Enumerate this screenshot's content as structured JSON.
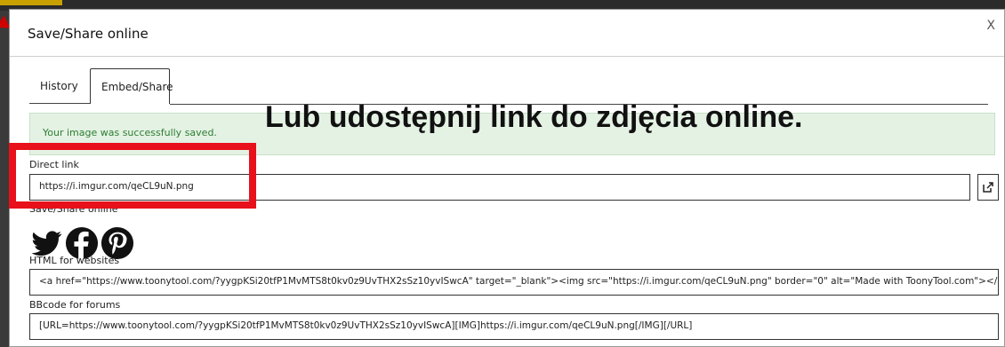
{
  "dialog": {
    "title": "Save/Share online",
    "close_label": "X"
  },
  "tabs": [
    {
      "label": "History"
    },
    {
      "label": "Embed/Share"
    }
  ],
  "alert": {
    "message": "Your image was successfully saved."
  },
  "overlay_caption": "Lub udostępnij link do zdjęcia online.",
  "direct_link": {
    "label": "Direct link",
    "value": "https://i.imgur.com/qeCL9uN.png"
  },
  "share": {
    "label": "Save/Share online",
    "icons": [
      "twitter-icon",
      "facebook-icon",
      "pinterest-icon"
    ]
  },
  "html_websites": {
    "label": "HTML for websites",
    "value": "<a href=\"https://www.toonytool.com/?yygpKSi20tfP1MvMTS8t0kv0z9UvTHX2sSz10yvISwcA\" target=\"_blank\"><img src=\"https://i.imgur.com/qeCL9uN.png\" border=\"0\" alt=\"Made with ToonyTool.com\"></a>"
  },
  "bbcode": {
    "label": "BBcode for forums",
    "value": "[URL=https://www.toonytool.com/?yygpKSi20tfP1MvMTS8t0kv0z9UvTHX2sSz10yvISwcA][IMG]https://i.imgur.com/qeCL9uN.png[/IMG][/URL]"
  },
  "colors": {
    "highlight": "#e8101a",
    "alert_bg": "#e4f2e4",
    "alert_text": "#2e7d32"
  }
}
